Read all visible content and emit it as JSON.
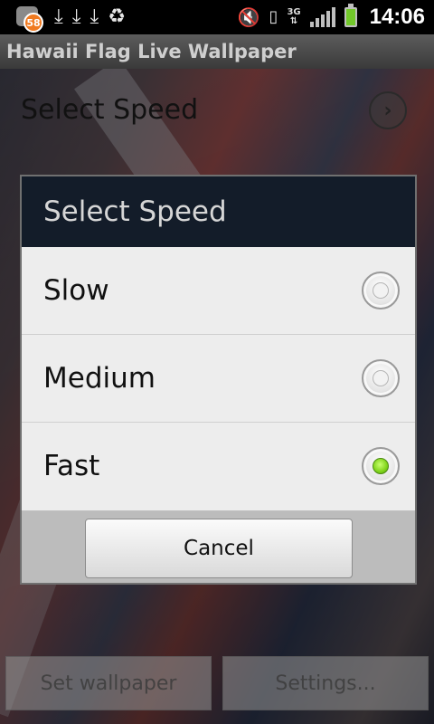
{
  "status_bar": {
    "notification_badge": "58",
    "icons_left": [
      "app-notification-icon",
      "download-icon",
      "download-icon",
      "download-icon",
      "recycle-icon"
    ],
    "icons_right": [
      "mute-icon",
      "vibrate-icon",
      "3g-data-icon",
      "signal-icon",
      "battery-icon"
    ],
    "network_type": "3G",
    "time": "14:06"
  },
  "app": {
    "title": "Hawaii Flag Live Wallpaper"
  },
  "preference": {
    "title": "Select Speed"
  },
  "dialog": {
    "title": "Select Speed",
    "options": [
      {
        "label": "Slow",
        "checked": false
      },
      {
        "label": "Medium",
        "checked": false
      },
      {
        "label": "Fast",
        "checked": true
      }
    ],
    "cancel_label": "Cancel"
  },
  "bottom_buttons": {
    "set_wallpaper": "Set wallpaper",
    "settings": "Settings..."
  },
  "colors": {
    "dialog_header": "#131c29",
    "radio_checked": "#7fd31a"
  }
}
